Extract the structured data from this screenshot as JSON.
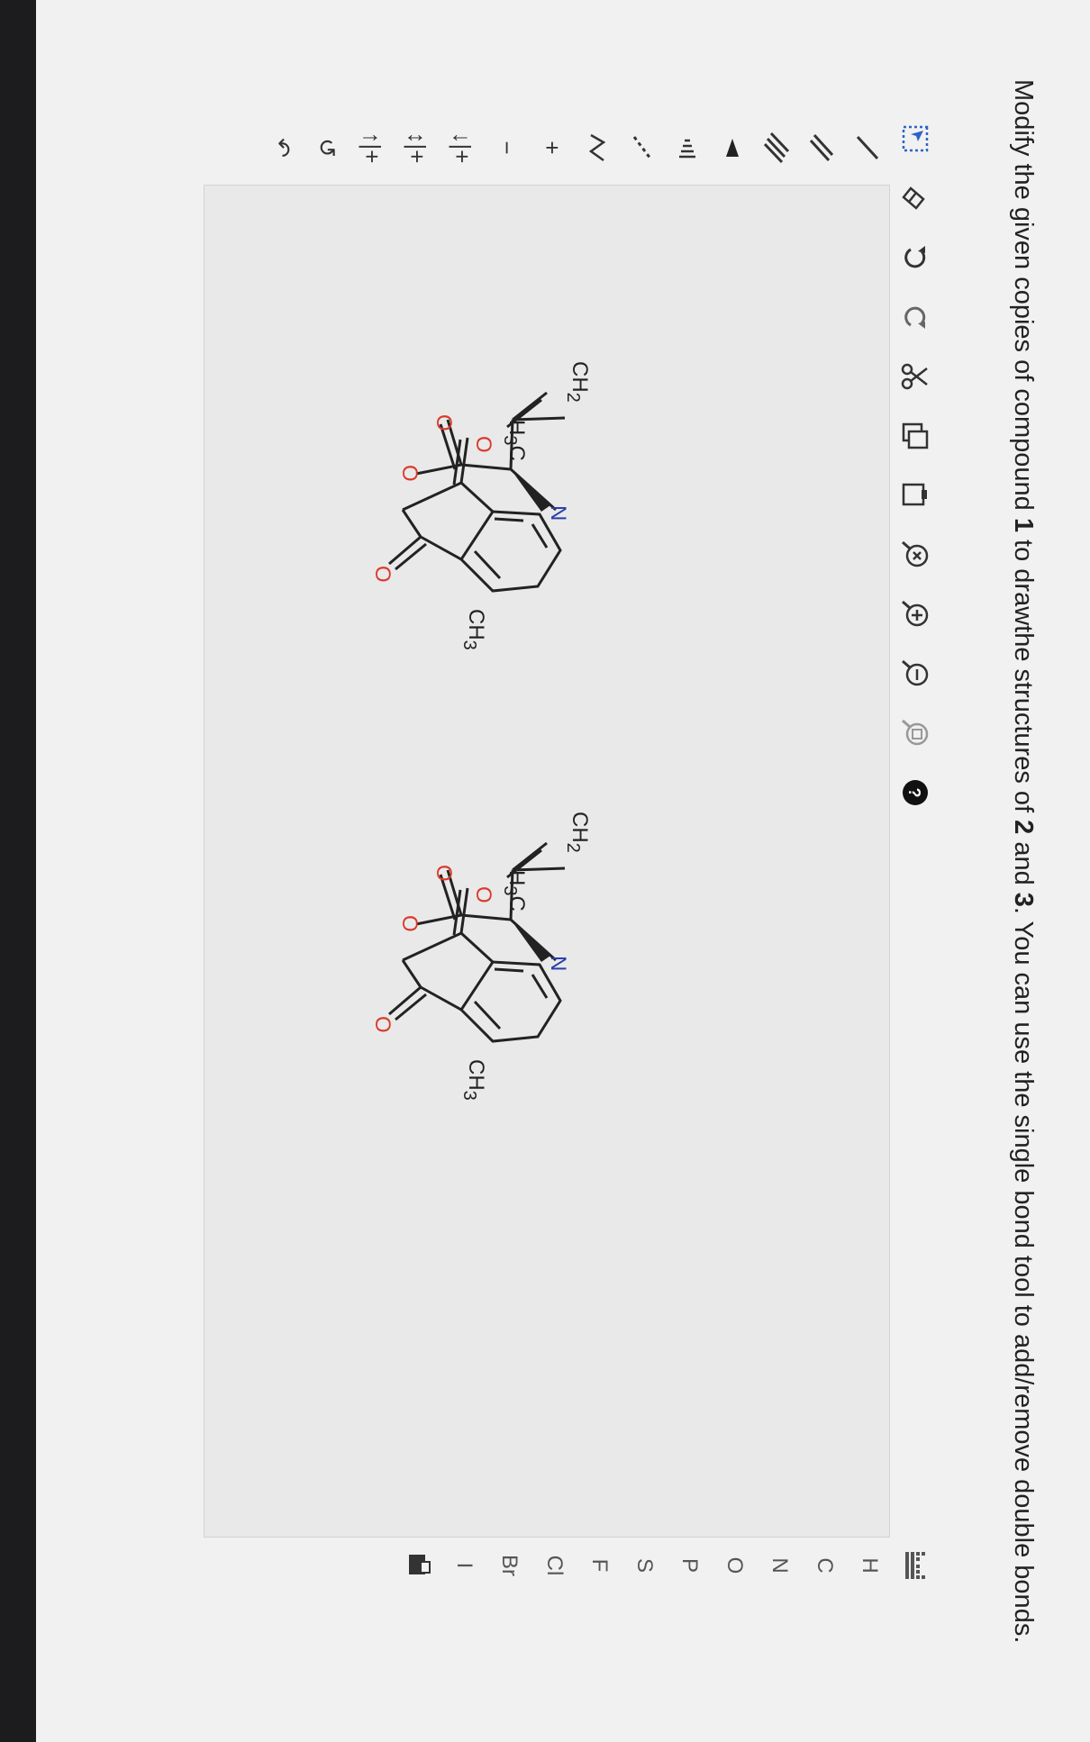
{
  "instructions": {
    "part1": "Modify the given copies of compound ",
    "n1": "1",
    "part2": " to drawthe structures of ",
    "n2": "2",
    "part3": " and ",
    "n3": "3",
    "part4": ". You can use the single bond tool to add/remove double bonds."
  },
  "toolbar": {
    "icons": [
      "select-icon",
      "eraser-icon",
      "undo-icon",
      "redo-icon",
      "cut-icon",
      "copy-icon",
      "paste-icon",
      "zoom-reset-icon",
      "zoom-in-icon",
      "zoom-out-icon",
      "zoom-fit-icon",
      "help-icon"
    ]
  },
  "left_tools": {
    "labels": [
      "/",
      "//",
      "///",
      "▲",
      "|||",
      "\\\\",
      "Z",
      "+",
      "−",
      "↓|+",
      "↕|+",
      "↑|+",
      "↺",
      "↶"
    ]
  },
  "elements": [
    "H",
    "C",
    "N",
    "O",
    "P",
    "S",
    "F",
    "Cl",
    "Br",
    "I"
  ],
  "molecule": {
    "ch2": "CH",
    "ch2_sub": "2",
    "h3c": "H",
    "h3c_sub": "3",
    "h3c_c": "C",
    "o": "O",
    "n": "N",
    "ch3": "CH",
    "ch3_sub": "3"
  },
  "colors": {
    "oxygen": "#d93a2b",
    "nitrogen": "#2a3ea8",
    "bond": "#222222"
  }
}
